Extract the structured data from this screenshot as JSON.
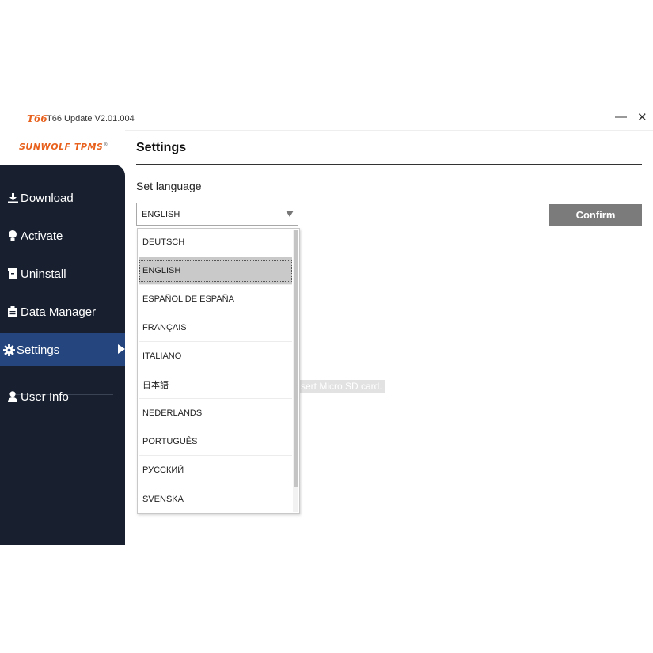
{
  "window": {
    "logo_text": "T66",
    "title": "T66 Update  V2.01.004",
    "minimize_glyph": "—",
    "close_glyph": "✕"
  },
  "brand": {
    "name": "SUNWOLF TPMS",
    "mark": "®"
  },
  "sidebar": {
    "items": [
      {
        "label": "Download",
        "icon": "download-icon"
      },
      {
        "label": "Activate",
        "icon": "bulb-icon"
      },
      {
        "label": "Uninstall",
        "icon": "trash-icon"
      },
      {
        "label": "Data Manager",
        "icon": "clipboard-icon"
      },
      {
        "label": "Settings",
        "icon": "gear-icon",
        "active": true
      },
      {
        "label": "User Info",
        "icon": "user-icon"
      }
    ]
  },
  "main": {
    "title": "Settings",
    "language_label": "Set language",
    "language_select": {
      "value": "ENGLISH",
      "options": [
        "DEUTSCH",
        "ENGLISH",
        "ESPAÑOL DE ESPAÑA",
        "FRANÇAIS",
        "ITALIANO",
        "日本語",
        "NEDERLANDS",
        "PORTUGUÊS",
        "РУССКИЙ",
        "SVENSKA"
      ],
      "selected_index": 1
    },
    "confirm_label": "Confirm",
    "hint_text": "sert Micro SD card."
  },
  "colors": {
    "accent": "#e8611d",
    "sidebar_bg": "#182030",
    "sidebar_active": "#24457e",
    "confirm_bg": "#7b7b7b"
  }
}
